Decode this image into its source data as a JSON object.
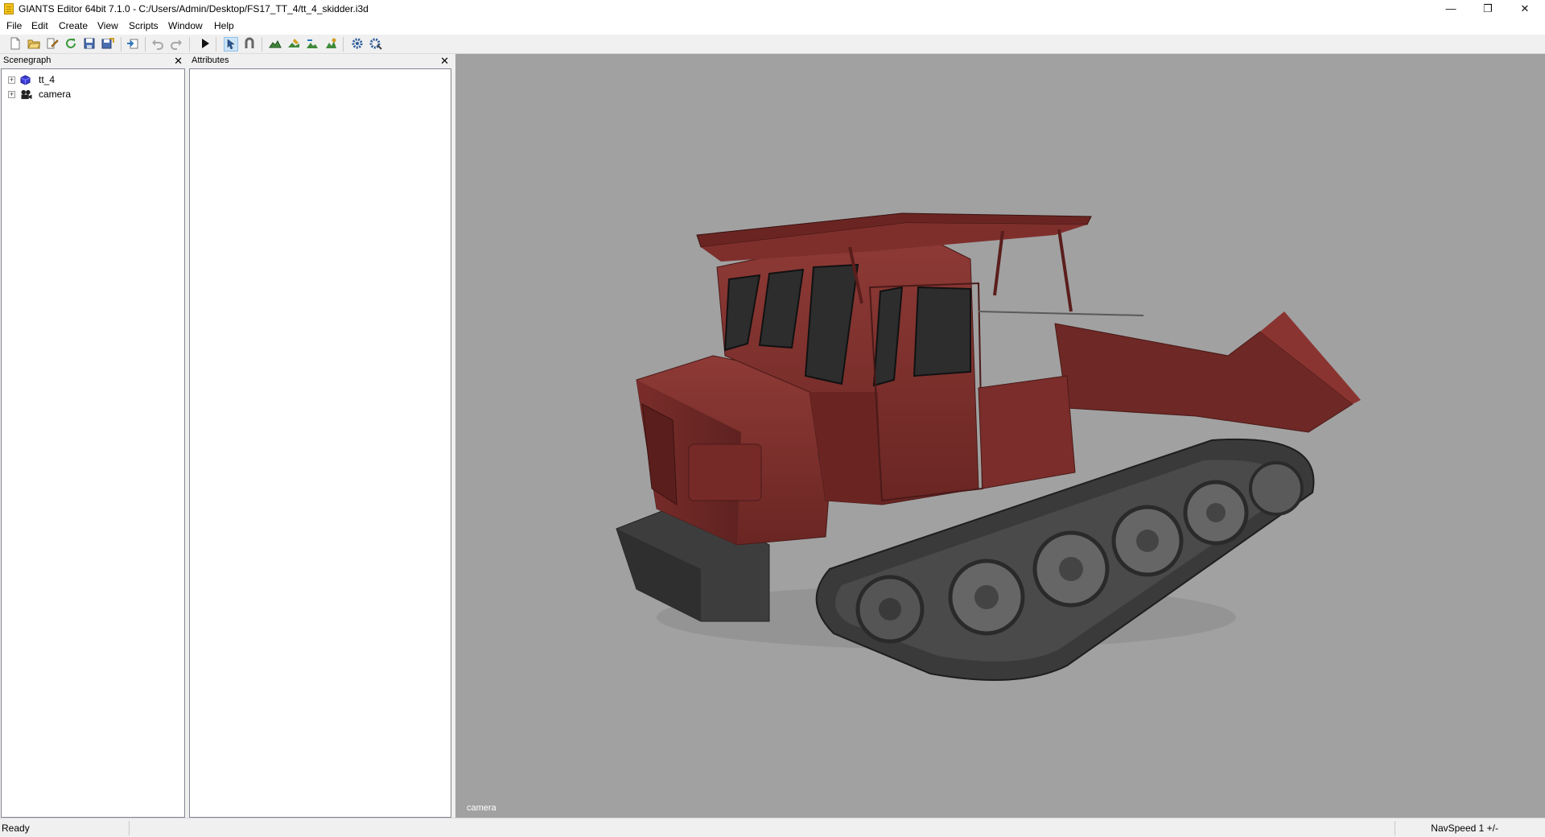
{
  "window": {
    "title": "GIANTS Editor 64bit 7.1.0 - C:/Users/Admin/Desktop/FS17_TT_4/tt_4_skidder.i3d",
    "controls": {
      "minimize": "—",
      "restore": "❐",
      "close": "✕"
    }
  },
  "menu": [
    "File",
    "Edit",
    "Create",
    "View",
    "Scripts",
    "Window",
    "Help"
  ],
  "toolbar": {
    "buttons": [
      "new-file-icon",
      "open-file-icon",
      "edit-file-icon",
      "reload-icon",
      "save-icon",
      "save-as-icon",
      "import-icon",
      "undo-icon",
      "redo-icon",
      "play-icon",
      "select-mode-icon",
      "magnet-icon",
      "terrain-sculpt-icon",
      "terrain-paint-icon",
      "foliage-paint-icon",
      "object-paint-icon",
      "game-settings-icon",
      "script-settings-icon"
    ],
    "active": "select-mode-icon"
  },
  "scenegraph": {
    "title": "Scenegraph",
    "nodes": [
      {
        "label": "tt_4",
        "icon": "transform-group-icon"
      },
      {
        "label": "camera",
        "icon": "camera-icon"
      }
    ]
  },
  "attributes": {
    "title": "Attributes"
  },
  "viewport": {
    "camera_label": "camera",
    "model": "red tracked skidder tractor with cab and rear blade"
  },
  "status": {
    "text": "Ready",
    "nav_speed": "NavSpeed 1 +/-"
  },
  "colors": {
    "viewport_bg": "#a1a1a1",
    "vehicle_red": "#7d2e2b",
    "track_dark": "#3a3a3a",
    "selection_blue": "#cce4f7"
  }
}
